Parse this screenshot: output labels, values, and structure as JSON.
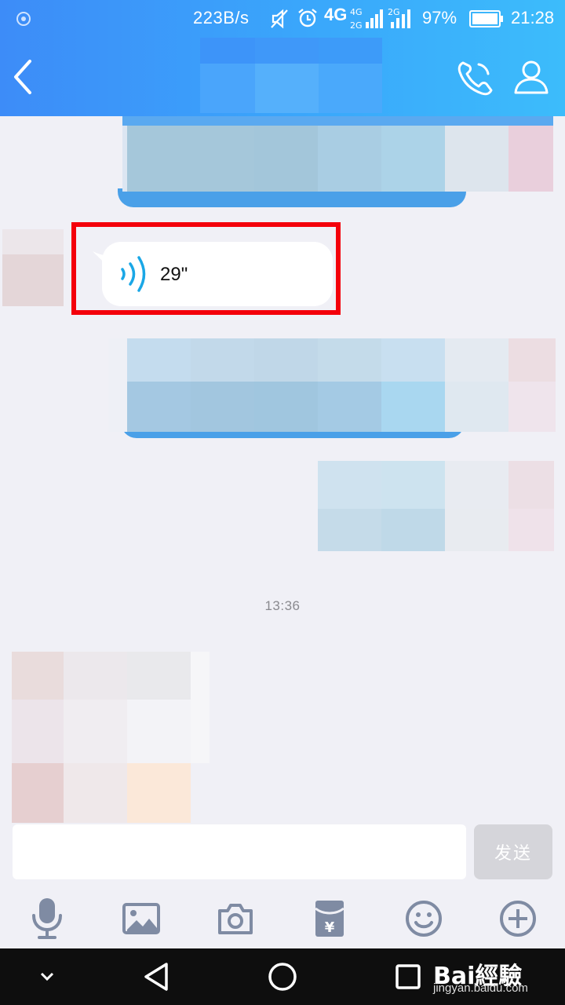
{
  "status_bar": {
    "network_speed": "223B/s",
    "network_type": "4G",
    "battery_percent": "97%",
    "time": "21:28",
    "icons": [
      "app-notification-icon",
      "mute-icon",
      "alarm-icon",
      "4g-icon",
      "signal-4g-2g-icon",
      "signal-2g-icon",
      "battery-icon"
    ]
  },
  "header": {
    "icons": {
      "back": "back-chevron-icon",
      "call": "phone-icon",
      "profile": "person-icon"
    }
  },
  "chat": {
    "voice_message": {
      "duration": "29\"",
      "icon": "voice-wave-icon"
    },
    "timestamp": "13:36"
  },
  "composer": {
    "input_value": "",
    "send_label": "发送",
    "toolbar_icons": [
      "microphone-icon",
      "image-icon",
      "camera-icon",
      "red-packet-icon",
      "emoji-icon",
      "plus-icon"
    ]
  },
  "system_nav": {
    "keys": [
      "collapse-chevron-icon",
      "back-triangle-icon",
      "home-circle-icon",
      "recents-square-icon"
    ]
  },
  "watermark": {
    "logo": "Bai經驗",
    "url": "jingyan.baidu.com"
  },
  "colors": {
    "header_start": "#3d8cf8",
    "header_end": "#3cbcfb",
    "accent": "#1aa7e6",
    "highlight": "#f4000b",
    "chat_bg": "#f0f0f6"
  }
}
